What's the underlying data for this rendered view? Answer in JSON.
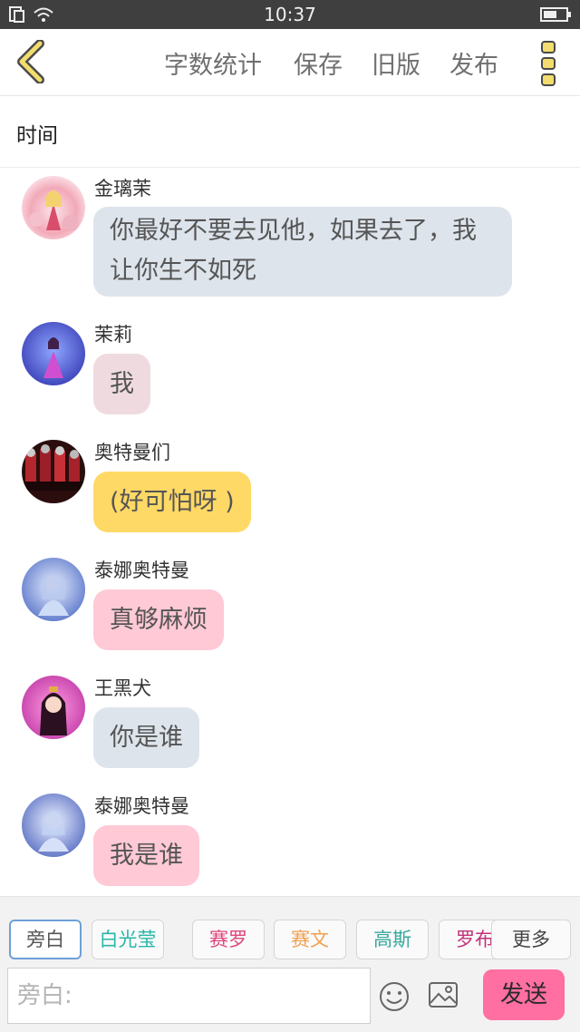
{
  "status_bar": {
    "time": "10:37"
  },
  "toolbar": {
    "word_count": "字数统计",
    "save": "保存",
    "old_version": "旧版",
    "publish": "发布"
  },
  "title": "时间",
  "messages": [
    {
      "name": "金璃茉",
      "text": [
        "你最好不要去见他，如果去了，我",
        "让你生不如死"
      ],
      "bubble_color": "#dde4ec"
    },
    {
      "name": "茉莉",
      "text": [
        "我"
      ],
      "bubble_color": "#efdbdf"
    },
    {
      "name": "奥特曼们",
      "text": [
        "(好可怕呀 )"
      ],
      "bubble_color": "#ffd966"
    },
    {
      "name": "泰娜奥特曼",
      "text": [
        "真够麻烦"
      ],
      "bubble_color": "#ffc9d6"
    },
    {
      "name": "王黑犬",
      "text": [
        "你是谁"
      ],
      "bubble_color": "#dde4ec"
    },
    {
      "name": "泰娜奥特曼",
      "text": [
        "我是谁"
      ],
      "bubble_color": "#ffc9d6"
    }
  ],
  "characters": [
    {
      "label": "旁白",
      "color": "#555555",
      "active": true
    },
    {
      "label": "白光莹",
      "color": "#29b6a9"
    },
    {
      "label": "赛罗",
      "color": "#e0457c"
    },
    {
      "label": "赛文",
      "color": "#f0a050"
    },
    {
      "label": "高斯",
      "color": "#38a89c"
    },
    {
      "label": "罗布",
      "color": "#c2317a"
    }
  ],
  "more_label": "更多",
  "input": {
    "placeholder": "旁白:"
  },
  "send_label": "发送",
  "icons": [
    "back-chevron-icon",
    "more-menu-icon",
    "emoji-icon",
    "image-icon",
    "wifi-icon",
    "sim-icon",
    "battery-icon"
  ],
  "accent": {
    "toolbar_icon": "#f2dd6e",
    "send_button": "#ff6fa1"
  }
}
